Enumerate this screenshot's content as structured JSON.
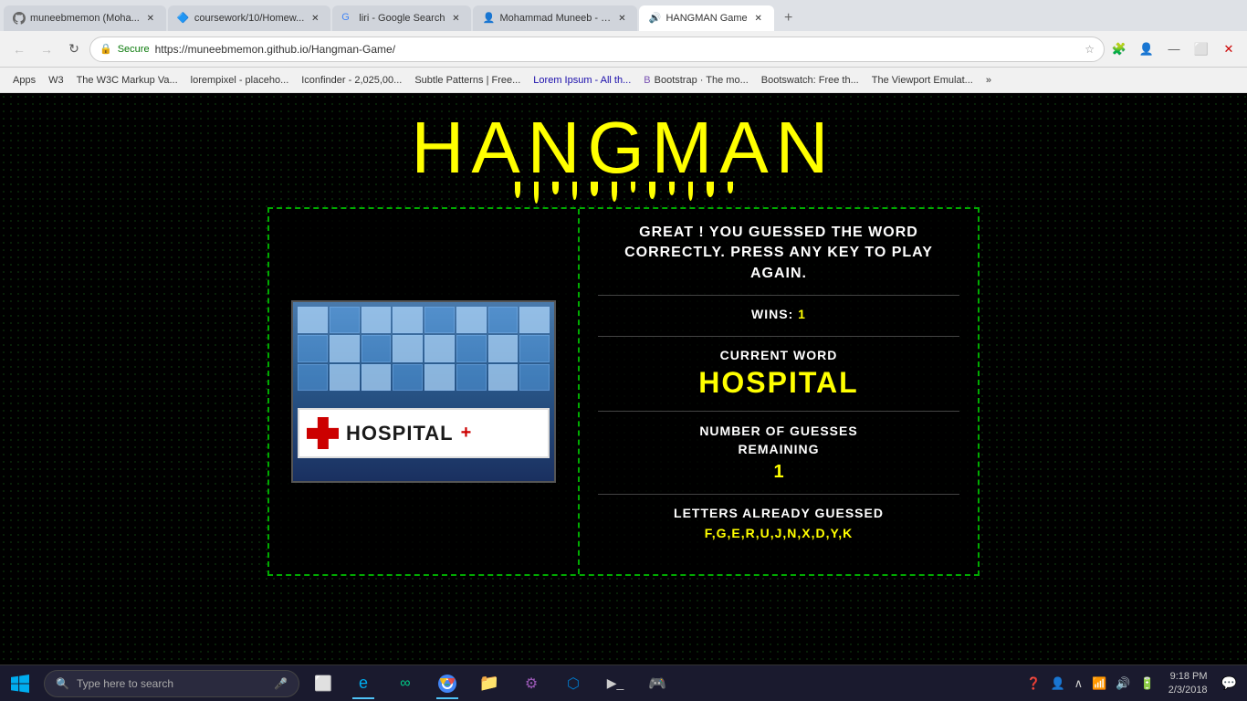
{
  "browser": {
    "tabs": [
      {
        "id": 1,
        "title": "muneebmemon (Moha...",
        "active": false,
        "icon": "github"
      },
      {
        "id": 2,
        "title": "coursework/10/Homew...",
        "active": false,
        "icon": "coursework"
      },
      {
        "id": 3,
        "title": "liri - Google Search",
        "active": false,
        "icon": "google"
      },
      {
        "id": 4,
        "title": "Mohammad Muneeb - P...",
        "active": false,
        "icon": "profile"
      },
      {
        "id": 5,
        "title": "HANGMAN Game",
        "active": true,
        "icon": "hangman"
      }
    ],
    "url": "https://muneebmemon.github.io/Hangman-Game/",
    "secure_label": "Secure"
  },
  "bookmarks": [
    "Apps",
    "W3",
    "The W3C Markup Va...",
    "lorempixel - placeho...",
    "Iconfinder - 2,025,00...",
    "Subtle Patterns | Free...",
    "Lorem Ipsum - All th...",
    "Bootstrap · The mo...",
    "Bootswatch: Free th...",
    "The Viewport Emulat..."
  ],
  "game": {
    "title": "HANGMAN",
    "message": "GREAT ! YOU GUESSED THE WORD CORRECTLY. PRESS ANY KEY TO PLAY AGAIN.",
    "wins_label": "WINS:",
    "wins_value": "1",
    "current_word_label": "CURRENT WORD",
    "current_word_value": "HOSPITAL",
    "guesses_label": "NUMBER OF GUESSES\nREMAINING",
    "guesses_value": "1",
    "letters_label": "LETTERS ALREADY GUESSED",
    "letters_value": "F,G,E,R,U,J,N,X,D,Y,K"
  },
  "taskbar": {
    "search_placeholder": "Type here to search",
    "time": "9:18 PM",
    "date": "2/3/2018"
  }
}
